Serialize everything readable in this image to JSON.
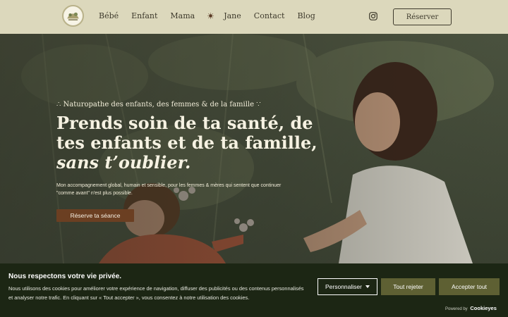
{
  "header": {
    "logo_icon": "illustrated-badge-logo",
    "nav": [
      "Bébé",
      "Enfant",
      "Mama",
      "Jane",
      "Contact",
      "Blog"
    ],
    "sun_icon": "sun-icon",
    "instagram_icon": "instagram-icon",
    "reserve_label": "Réserver "
  },
  "hero": {
    "eyebrow": "∴ Naturopathe des enfants, des femmes & de la famille ∵",
    "headline_line1": "Prends soin de ta santé, de",
    "headline_line2": "tes enfants et de ta famille,",
    "headline_line3": "sans t’oublier.",
    "intro": "Mon accompagnement global, humain et sensible, pour les femmes & mères qui sentent que continuer \"comme avant\" n'est plus possible.",
    "cta_label": "Réserve ta séance "
  },
  "cookie": {
    "title": "Nous respectons votre vie privée.",
    "text": "Nous utilisons des cookies pour améliorer votre expérience de navigation, diffuser des publicités ou des contenus personnalisés et analyser notre trafic. En cliquant sur « Tout accepter », vous consentez à notre utilisation des cookies.",
    "personalize_label": "Personnaliser",
    "reject_label": "Tout rejeter",
    "accept_label": "Accepter tout",
    "powered_prefix": "Powered by",
    "powered_brand": "Cookieyes"
  },
  "colors": {
    "header_bg": "#dcd8bc",
    "cta_bg": "#6b3f22",
    "cookie_bg": "#1c2614",
    "cookie_button_bg": "#5e6033"
  }
}
